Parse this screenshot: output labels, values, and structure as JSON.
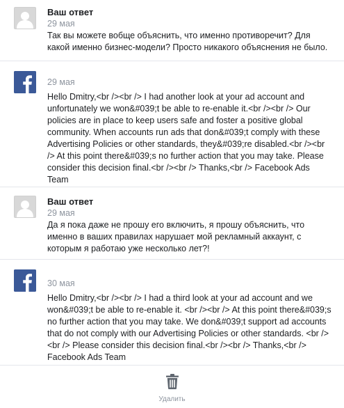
{
  "messages": [
    {
      "kind": "user",
      "author": "Ваш ответ",
      "date": "29 мая",
      "avatar_icon": "default-user-avatar",
      "text": "Так вы можете вобще объяснить, что именно противоречит? Для какой именно бизнес-модели? Просто никакого объяснения не было."
    },
    {
      "kind": "facebook",
      "author": "",
      "date": "29 мая",
      "avatar_icon": "facebook-logo-icon",
      "text": "Hello Dmitry,<br /><br /> I had another look at your ad account and unfortunately we won&#039;t be able to re-enable it.<br /><br /> Our policies are in place to keep users safe and foster a positive global community. When accounts run ads that don&#039;t comply with these Advertising Policies or other standards, they&#039;re disabled.<br /><br /> At this point there&#039;s no further action that you may take. Please consider this decision final.<br /><br /> Thanks,<br /> Facebook Ads Team"
    },
    {
      "kind": "user",
      "author": "Ваш ответ",
      "date": "29 мая",
      "avatar_icon": "default-user-avatar",
      "text": "Да я пока даже не прошу его включить, я прошу объяснить, что именно в ваших правилах нарушает мой рекламный аккаунт, с которым я работаю уже несколько лет?!"
    },
    {
      "kind": "facebook",
      "author": "",
      "date": "30 мая",
      "avatar_icon": "facebook-logo-icon",
      "text": "Hello Dmitry,<br /><br /> I had a third look at your ad account and we won&#039;t be able to re-enable it. <br /><br /> At this point there&#039;s no further action that you may take. We don&#039;t support ad accounts that do not comply with our Advertising Policies or other standards. <br /><br /> Please consider this decision final.<br /><br /> Thanks,<br /> Facebook Ads Team"
    }
  ],
  "footer": {
    "delete_label": "Удалить",
    "delete_icon": "trash-icon"
  },
  "colors": {
    "facebook_blue": "#3b5998",
    "muted_text": "#8d949e",
    "divider": "#e4e6eb"
  }
}
